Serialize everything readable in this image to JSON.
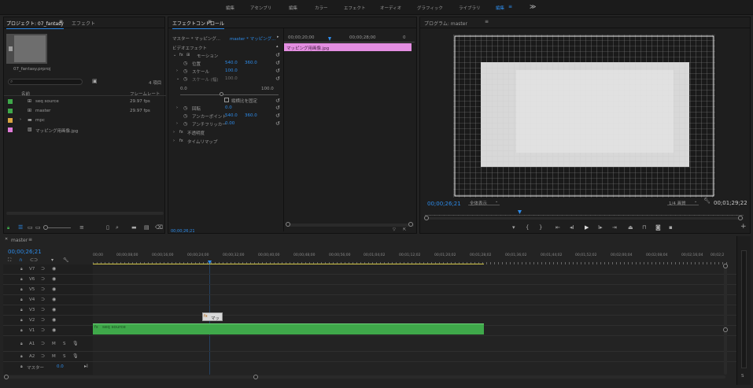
{
  "workspaces": {
    "items": [
      "編集",
      "アセンブリ",
      "編集",
      "カラー",
      "エフェクト",
      "オーディオ",
      "グラフィック",
      "ライブラリ",
      "編集"
    ],
    "active_index": 8,
    "more": "≫"
  },
  "project_panel": {
    "tab_project": "プロジェクト: 07_fantasy",
    "tab_effects": "エフェクト",
    "project_file": "07_fantasy.prproj",
    "item_count": "4 項目",
    "col_name": "名前",
    "col_framerate": "フレームレート",
    "items": [
      {
        "name": "seq source",
        "rate": "29.97 fps",
        "color": "#3fa84a"
      },
      {
        "name": "master",
        "rate": "29.97 fps",
        "color": "#3fa84a"
      },
      {
        "name": "mpc",
        "rate": "",
        "color": "#d9a441"
      },
      {
        "name": "マッピング用画像.jpg",
        "rate": "",
        "color": "#e07bd8"
      }
    ]
  },
  "effect_controls": {
    "tab": "エフェクトコントロール",
    "master_label": "マスター * マッピング...",
    "seq_label": "master * マッピング...",
    "section_video": "ビデオエフェクト",
    "motion": "モーション",
    "position_label": "位置",
    "position_x": "540.0",
    "position_y": "360.0",
    "scale_label": "スケール",
    "scale_value": "100.0",
    "scale_width_label": "スケール (幅)",
    "scale_width_value": "100.0",
    "slider_min": "0.0",
    "slider_max": "100.0",
    "uniform_scale": "縦横比を固定",
    "rotation_label": "回転",
    "rotation_value": "0.0",
    "anchor_label": "アンカーポイント",
    "anchor_x": "540.0",
    "anchor_y": "360.0",
    "flicker_label": "アンチフリッカー",
    "flicker_value": "0.00",
    "opacity_label": "不透明度",
    "timeremap_label": "タイムリマップ",
    "ruler_time1": "00;00;20;00",
    "ruler_time2": "00;00;28;00",
    "ruler_time3": "0",
    "clip_name": "マッピング用画像.jpg",
    "bottom_time": "00;00;26;21"
  },
  "program_monitor": {
    "tab": "プログラム: master",
    "timecode": "00;00;26;21",
    "fit": "全体表示",
    "quality": "1/4 画質",
    "duration": "00;01;29;22"
  },
  "timeline": {
    "tab": "master",
    "timecode": "00;00;26;21",
    "ruler": [
      "00;00",
      "00;00;08;00",
      "00;00;16;00",
      "00;00;24;00",
      "00;00;32;00",
      "00;00;40;00",
      "00;00;48;00",
      "00;00;56;00",
      "00;01;04;02",
      "00;01;12;02",
      "00;01;20;02",
      "00;01;28;02",
      "00;01;36;02",
      "00;01;44;02",
      "00;01;52;02",
      "00;02;00;04",
      "00;02;08;04",
      "00;02;16;04",
      "00;02;2"
    ],
    "video_tracks": [
      "V7",
      "V6",
      "V5",
      "V4",
      "V3",
      "V2",
      "V1"
    ],
    "audio_tracks": [
      "A1",
      "A2"
    ],
    "master_label": "マスター",
    "master_value": "0.0",
    "clip_v1": "seq source",
    "clip_v2": "マッ"
  }
}
